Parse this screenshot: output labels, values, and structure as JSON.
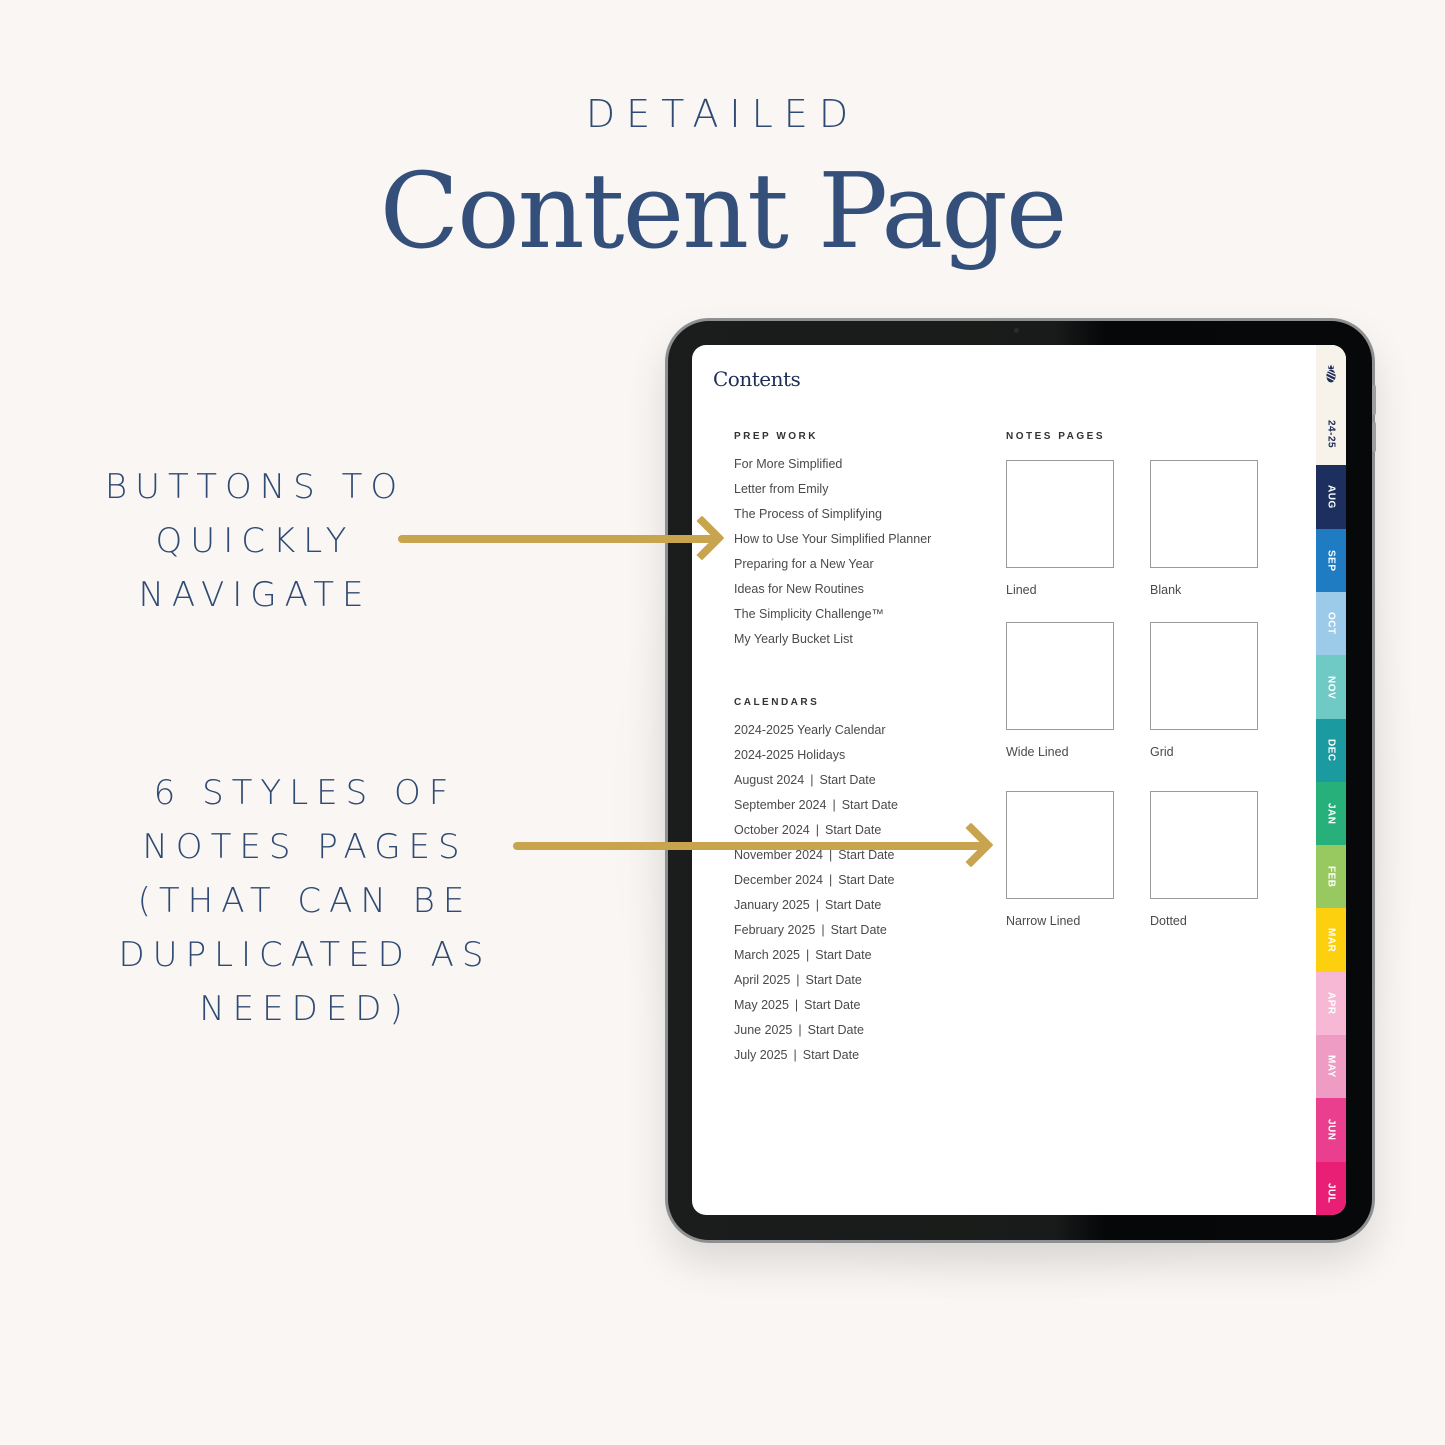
{
  "header": {
    "eyebrow": "DETAILED",
    "title": "Content Page"
  },
  "callouts": [
    {
      "lines": [
        "BUTTONS TO",
        "QUICKLY",
        "NAVIGATE"
      ]
    },
    {
      "lines": [
        "6 STYLES OF",
        "NOTES PAGES",
        "(THAT CAN BE",
        "DUPLICATED AS",
        "NEEDED)"
      ]
    }
  ],
  "colors": {
    "navy": "#2f4a73",
    "arrow_gold": "#c9a44f"
  },
  "screen": {
    "title": "Contents",
    "prep_work": {
      "label": "PREP WORK",
      "items": [
        "For More Simplified",
        "Letter from Emily",
        "The Process of Simplifying",
        "How to Use Your Simplified Planner",
        "Preparing for a New Year",
        "Ideas for New Routines",
        "The Simplicity Challenge™",
        "My Yearly Bucket List"
      ]
    },
    "calendars": {
      "label": "CALENDARS",
      "items": [
        {
          "name": "2024-2025 Yearly Calendar"
        },
        {
          "name": "2024-2025 Holidays"
        },
        {
          "name": "August 2024",
          "suffix": "Start Date"
        },
        {
          "name": "September 2024",
          "suffix": "Start Date"
        },
        {
          "name": "October 2024",
          "suffix": "Start Date"
        },
        {
          "name": "November 2024",
          "suffix": "Start Date"
        },
        {
          "name": "December 2024",
          "suffix": "Start Date"
        },
        {
          "name": "January 2025",
          "suffix": "Start Date"
        },
        {
          "name": "February 2025",
          "suffix": "Start Date"
        },
        {
          "name": "March 2025",
          "suffix": "Start Date"
        },
        {
          "name": "April 2025",
          "suffix": "Start Date"
        },
        {
          "name": "May 2025",
          "suffix": "Start Date"
        },
        {
          "name": "June 2025",
          "suffix": "Start Date"
        },
        {
          "name": "July 2025",
          "suffix": "Start Date"
        }
      ],
      "separator": "|"
    },
    "notes_pages": {
      "label": "NOTES PAGES",
      "items": [
        {
          "label": "Lined",
          "style": "lined"
        },
        {
          "label": "Blank",
          "style": "blank"
        },
        {
          "label": "Wide Lined",
          "style": "wide"
        },
        {
          "label": "Grid",
          "style": "grid"
        },
        {
          "label": "Narrow Lined",
          "style": "narrow"
        },
        {
          "label": "Dotted",
          "style": "dotted"
        }
      ]
    },
    "tabs": [
      {
        "icon": "pineapple-icon"
      },
      {
        "label": "24-25",
        "bg": "#f7f2ea",
        "fg": "#1e2f57"
      },
      {
        "label": "AUG",
        "bg": "#1c2f5e",
        "fg": "#ffffff"
      },
      {
        "label": "SEP",
        "bg": "#1f7bc2",
        "fg": "#ffffff"
      },
      {
        "label": "OCT",
        "bg": "#9ccbea",
        "fg": "#ffffff"
      },
      {
        "label": "NOV",
        "bg": "#6fcac6",
        "fg": "#ffffff"
      },
      {
        "label": "DEC",
        "bg": "#1b9aa0",
        "fg": "#ffffff"
      },
      {
        "label": "JAN",
        "bg": "#27b07a",
        "fg": "#ffffff"
      },
      {
        "label": "FEB",
        "bg": "#98c860",
        "fg": "#ffffff"
      },
      {
        "label": "MAR",
        "bg": "#fdd00f",
        "fg": "#ffffff"
      },
      {
        "label": "APR",
        "bg": "#f6b8d5",
        "fg": "#ffffff"
      },
      {
        "label": "MAY",
        "bg": "#ef9cc4",
        "fg": "#ffffff"
      },
      {
        "label": "JUN",
        "bg": "#ea3f8e",
        "fg": "#ffffff"
      },
      {
        "label": "JUL",
        "bg": "#e91e75",
        "fg": "#ffffff"
      }
    ]
  }
}
